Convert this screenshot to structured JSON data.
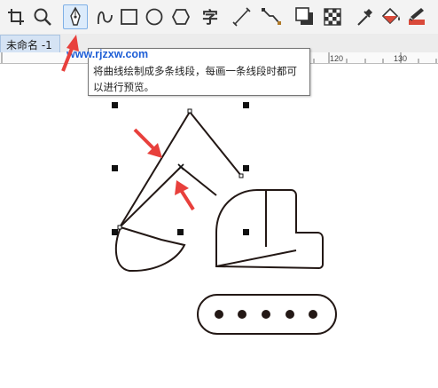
{
  "toolbar": {
    "tools": [
      {
        "name": "crop-tool",
        "icon": "crop-icon"
      },
      {
        "name": "zoom-tool",
        "icon": "magnifier-icon"
      },
      {
        "name": "pen-tool",
        "icon": "pen-nib-icon",
        "active": true
      },
      {
        "name": "b-spline-tool",
        "icon": "spline-icon"
      },
      {
        "name": "rectangle-tool",
        "icon": "rectangle-icon"
      },
      {
        "name": "ellipse-tool",
        "icon": "ellipse-icon"
      },
      {
        "name": "polygon-tool",
        "icon": "hexagon-icon"
      },
      {
        "name": "text-tool",
        "icon": "text-zi-icon",
        "label": "字"
      },
      {
        "name": "dimension-tool",
        "icon": "parallel-dimension-icon"
      },
      {
        "name": "connector-tool",
        "icon": "connector-icon"
      },
      {
        "name": "drop-shadow-tool",
        "icon": "drop-shadow-icon"
      },
      {
        "name": "transparency-tool",
        "icon": "checkerboard-icon"
      },
      {
        "name": "eyedropper-tool",
        "icon": "eyedropper-icon"
      },
      {
        "name": "interactive-fill-tool",
        "icon": "paint-bucket-icon"
      },
      {
        "name": "smart-fill-tool",
        "icon": "smart-fill-icon"
      }
    ]
  },
  "document_tab": {
    "label": "未命名 -1"
  },
  "ruler": {
    "labels": [
      "120",
      "130"
    ]
  },
  "tooltip": {
    "title": "www.rjzxw.com",
    "lines": [
      "将曲线绘制成多条线段，每画一条线段时都可",
      "以进行预览。"
    ]
  },
  "colors": {
    "accent": "#1f5fd6",
    "arrow": "#e8403c",
    "tab": "#d5e3f4",
    "drawing": "#231815"
  }
}
